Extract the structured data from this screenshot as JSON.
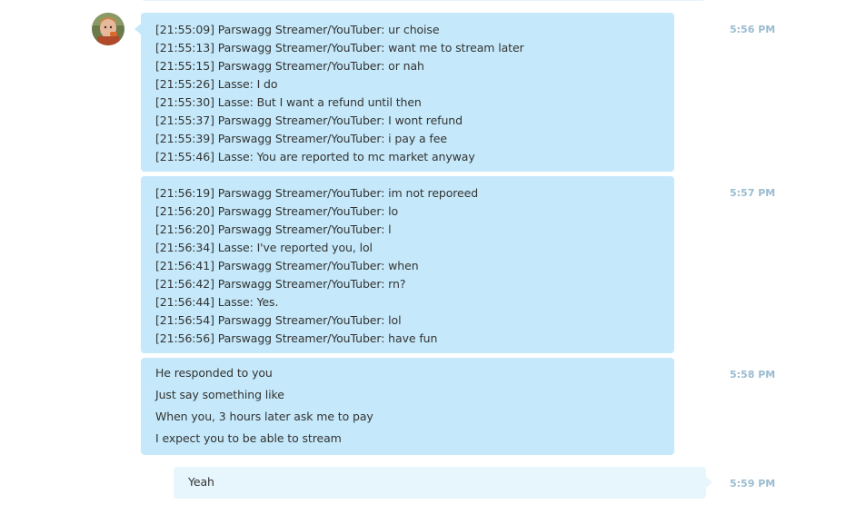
{
  "messages": [
    {
      "time": "5:56 PM",
      "lines": [
        "[21:55:09] Parswagg Streamer/YouTuber: ur choise",
        "[21:55:13] Parswagg Streamer/YouTuber: want me to stream later",
        "[21:55:15] Parswagg Streamer/YouTuber: or nah",
        "[21:55:26] Lasse: I do",
        "[21:55:30] Lasse: But I want a refund until then",
        "[21:55:37] Parswagg Streamer/YouTuber: I wont refund",
        "[21:55:39] Parswagg Streamer/YouTuber: i pay a fee",
        "[21:55:46] Lasse: You are reported to mc market anyway"
      ]
    },
    {
      "time": "5:57 PM",
      "lines": [
        "[21:56:19] Parswagg Streamer/YouTuber: im not reporeed",
        "[21:56:20] Parswagg Streamer/YouTuber: lo",
        "[21:56:20] Parswagg Streamer/YouTuber: l",
        "[21:56:34] Lasse: I've reported you, lol",
        "[21:56:41] Parswagg Streamer/YouTuber: when",
        "[21:56:42] Parswagg Streamer/YouTuber: rn?",
        "[21:56:44] Lasse: Yes.",
        "[21:56:54] Parswagg Streamer/YouTuber: lol",
        "[21:56:56] Parswagg Streamer/YouTuber: have fun"
      ]
    },
    {
      "time": "5:58 PM",
      "lines": [
        "He responded to you",
        "Just say something like",
        "When you, 3 hours later ask me to pay",
        "I expect you to be able to stream"
      ]
    },
    {
      "time": "5:59 PM",
      "lines": [
        "Yeah"
      ]
    }
  ]
}
